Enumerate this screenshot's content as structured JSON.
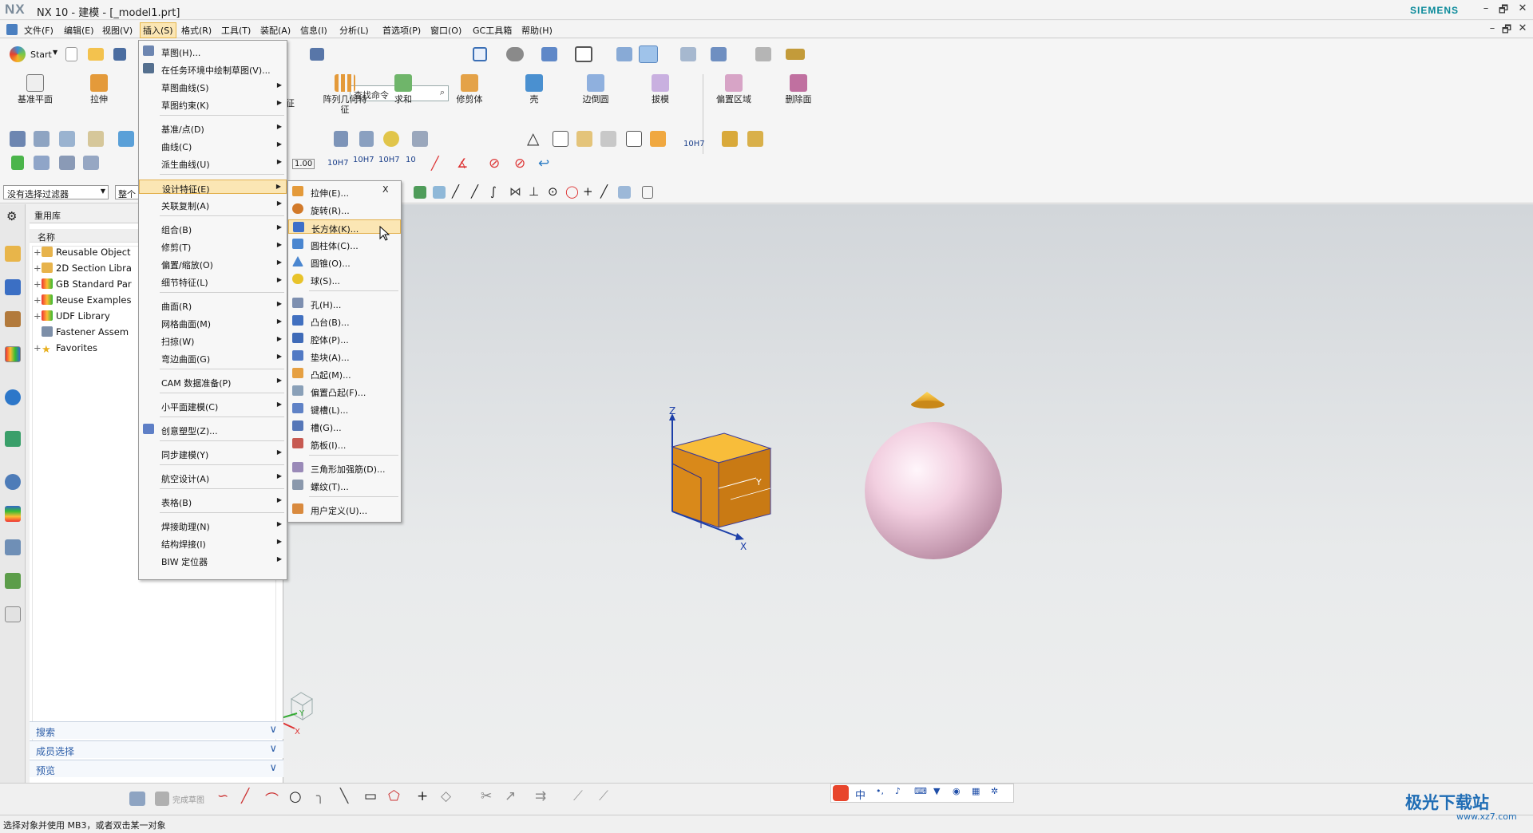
{
  "window": {
    "logo": "NX",
    "title": "NX 10 - 建模 - [_model1.prt]",
    "brand": "SIEMENS",
    "controls": [
      "–",
      "🗗",
      "✕"
    ],
    "sub_controls": [
      "–",
      "🗗",
      "✕"
    ]
  },
  "menubar": [
    "文件(F)",
    "编辑(E)",
    "视图(V)",
    "插入(S)",
    "格式(R)",
    "工具(T)",
    "装配(A)",
    "信息(I)",
    "分析(L)",
    "首选项(P)",
    "窗口(O)",
    "GC工具箱",
    "帮助(H)"
  ],
  "toolbar": {
    "start_label": "Start",
    "search_placeholder": "查找命令",
    "large_buttons": [
      "基准平面",
      "拉伸",
      "征",
      "阵列几何特征",
      "求和",
      "修剪体",
      "壳",
      "边倒圆",
      "拔模",
      "偏置区域",
      "删除面"
    ],
    "dimension_labels": [
      "1.00",
      "10H7",
      "10H7",
      "10H7",
      "10",
      "10H7"
    ],
    "filter_value": "没有选择过滤器",
    "filter_scope": "整个"
  },
  "navigator": {
    "title": "重用库",
    "column_header": "名称",
    "items": [
      "Reusable Object",
      "2D Section Libra",
      "GB Standard Par",
      "Reuse Examples",
      "UDF Library",
      "Fastener Assem",
      "Favorites"
    ],
    "accordions": [
      "搜索",
      "成员选择",
      "预览"
    ]
  },
  "insert_menu": {
    "items": [
      "草图(H)...",
      "在任务环境中绘制草图(V)...",
      "草图曲线(S)",
      "草图约束(K)",
      "基准/点(D)",
      "曲线(C)",
      "派生曲线(U)",
      "设计特征(E)",
      "关联复制(A)",
      "组合(B)",
      "修剪(T)",
      "偏置/缩放(O)",
      "细节特征(L)",
      "曲面(R)",
      "网格曲面(M)",
      "扫掠(W)",
      "弯边曲面(G)",
      "CAM 数据准备(P)",
      "小平面建模(C)",
      "创意塑型(Z)...",
      "同步建模(Y)",
      "航空设计(A)",
      "表格(B)",
      "焊接助理(N)",
      "结构焊接(I)",
      "BIW 定位器"
    ]
  },
  "design_feature_menu": {
    "close": "X",
    "items": [
      "拉伸(E)...",
      "旋转(R)...",
      "长方体(K)...",
      "圆柱体(C)...",
      "圆锥(O)...",
      "球(S)...",
      "孔(H)...",
      "凸台(B)...",
      "腔体(P)...",
      "垫块(A)...",
      "凸起(M)...",
      "偏置凸起(F)...",
      "键槽(L)...",
      "槽(G)...",
      "筋板(I)...",
      "三角形加强筋(D)...",
      "螺纹(T)...",
      "用户定义(U)..."
    ],
    "highlighted": "长方体(K)..."
  },
  "viewport": {
    "axis_labels": {
      "x": "X",
      "y": "Y",
      "z": "Z"
    },
    "mini_axis": {
      "x": "X",
      "y": "Y",
      "z": "Z"
    }
  },
  "bottom_toolbar": {
    "finish_sketch": "完成草图"
  },
  "ime": {
    "label": "中"
  },
  "status": "选择对象并使用 MB3，或者双击某一对象",
  "watermark": {
    "main": "极光下载站",
    "sub": "www.xz7.com"
  },
  "colors": {
    "highlight": "#fbe6b4",
    "accent_blue": "#2b5da8",
    "box_orange": "#f0a818",
    "sphere_pink": "#f2cdde",
    "brand_teal": "#0a8a9a"
  }
}
